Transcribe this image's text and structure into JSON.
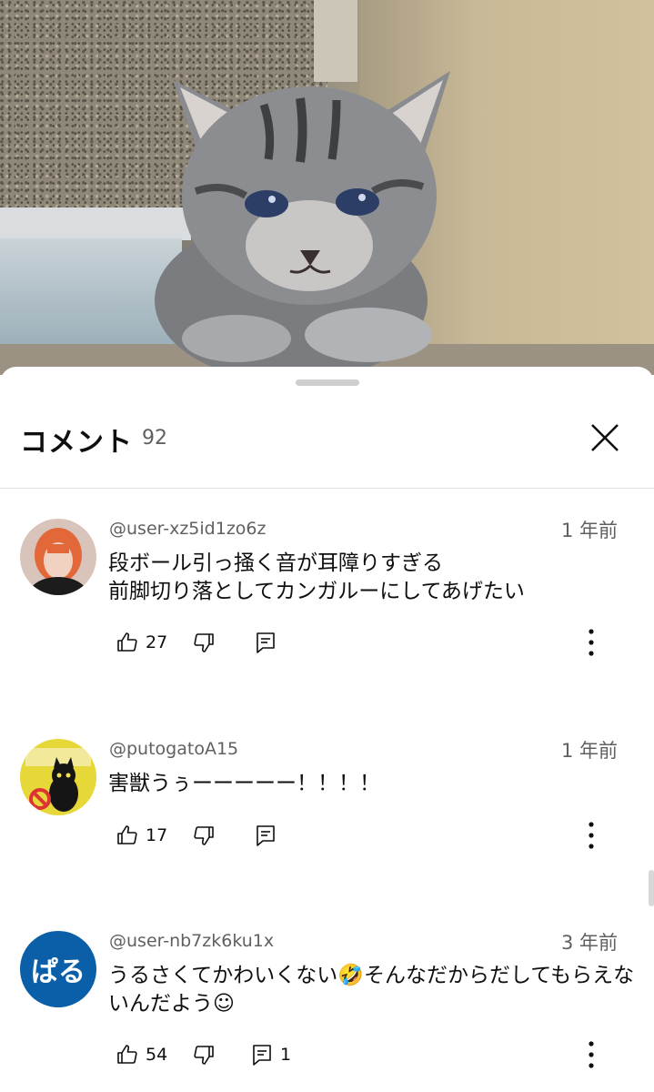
{
  "header": {
    "title": "コメント",
    "count": "92"
  },
  "comments": [
    {
      "author": "@user-xz5id1zo6z",
      "time": "1 年前",
      "text": "段ボール引っ掻く音が耳障りすぎる\n前脚切り落としてカンガルーにしてあげたい",
      "likes": "27",
      "replies": ""
    },
    {
      "author": "@putogatoA15",
      "time": "1 年前",
      "text": "害獣うぅーーーーー！！！！",
      "likes": "17",
      "replies": ""
    },
    {
      "author": "@user-nb7zk6ku1x",
      "time": "3 年前",
      "text": "うるさくてかわいくない🤣そんなだからだしてもらえないんだよう☺",
      "likes": "54",
      "replies": "1",
      "avatar_text": "ぱる"
    }
  ],
  "colors": {
    "avatar3": "#0a5fa8",
    "muted": "#606060"
  },
  "icons": [
    "close-icon",
    "thumbs-up-icon",
    "thumbs-down-icon",
    "reply-icon",
    "more-vert-icon"
  ]
}
